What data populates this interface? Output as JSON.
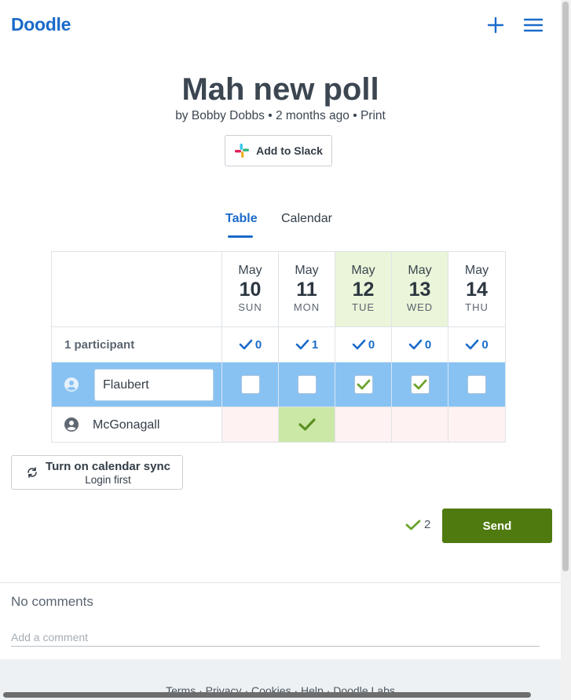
{
  "app": {
    "logo": "Doodle"
  },
  "poll": {
    "title": "Mah new poll",
    "meta_prefix": "by Bobby Dobbs • 2 months ago • ",
    "print_label": "Print"
  },
  "slack": {
    "label": "Add to Slack"
  },
  "tabs": [
    {
      "label": "Table",
      "active": true
    },
    {
      "label": "Calendar",
      "active": false
    }
  ],
  "table": {
    "participants_label": "1 participant",
    "dates": [
      {
        "month": "May",
        "day": "10",
        "weekday": "SUN",
        "count": "0",
        "highlighted": false
      },
      {
        "month": "May",
        "day": "11",
        "weekday": "MON",
        "count": "1",
        "highlighted": false
      },
      {
        "month": "May",
        "day": "12",
        "weekday": "TUE",
        "count": "0",
        "highlighted": true
      },
      {
        "month": "May",
        "day": "13",
        "weekday": "WED",
        "count": "0",
        "highlighted": true
      },
      {
        "month": "May",
        "day": "14",
        "weekday": "THU",
        "count": "0",
        "highlighted": false
      }
    ],
    "current_user": {
      "name_value": "Flaubert",
      "checked": [
        false,
        false,
        true,
        true,
        false
      ]
    },
    "participants": [
      {
        "name": "McGonagall",
        "votes": [
          false,
          true,
          false,
          false,
          false
        ]
      }
    ]
  },
  "calendar_sync": {
    "title": "Turn on calendar sync",
    "subtitle": "Login first"
  },
  "submit": {
    "yes_count": "2",
    "send_label": "Send"
  },
  "comments": {
    "empty_text": "No comments",
    "placeholder": "Add a comment"
  },
  "footer": {
    "links_text": "Terms · Privacy · Cookies · Help · Doodle Labs"
  },
  "colors": {
    "brand": "#1a6bc9",
    "send": "#4f7a0f",
    "yes": "#6aa32b",
    "active_row": "#88c2f2"
  }
}
